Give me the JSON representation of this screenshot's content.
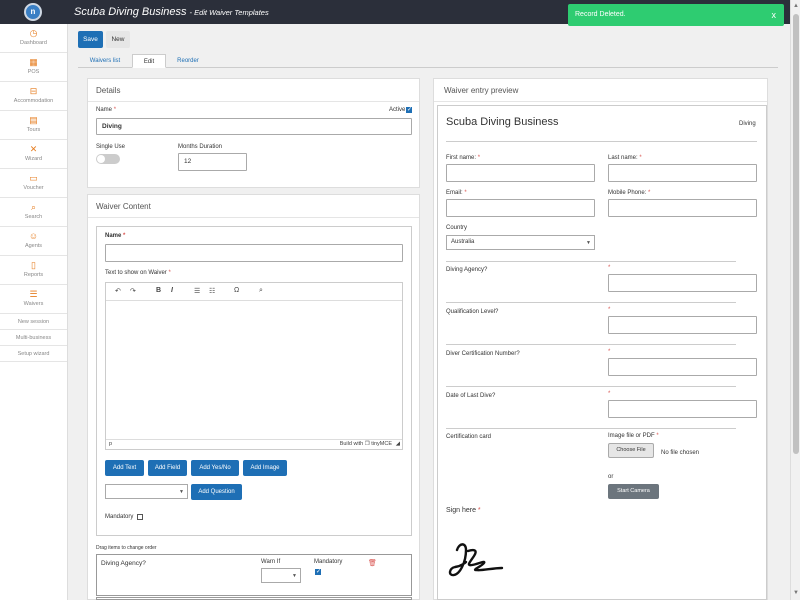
{
  "header": {
    "logo": "n",
    "title": "Scuba Diving Business",
    "subtitle": "- Edit Waiver Templates"
  },
  "toast": {
    "message": "Record Deleted.",
    "close": "x",
    "color": "#2ecc71"
  },
  "sidebar": {
    "items": [
      {
        "label": "Dashboard",
        "icon": "dashboard-icon",
        "glyph": "◷"
      },
      {
        "label": "POS",
        "icon": "pos-icon",
        "glyph": "▦"
      },
      {
        "label": "Accommodation",
        "icon": "bed-icon",
        "glyph": "⊟"
      },
      {
        "label": "Tours",
        "icon": "tours-icon",
        "glyph": "▤"
      },
      {
        "label": "Wizard",
        "icon": "wizard-icon",
        "glyph": "✕"
      },
      {
        "label": "Voucher",
        "icon": "voucher-icon",
        "glyph": "▭"
      },
      {
        "label": "Search",
        "icon": "search-icon",
        "glyph": "⌕"
      },
      {
        "label": "Agents",
        "icon": "agents-icon",
        "glyph": "☺"
      },
      {
        "label": "Reports",
        "icon": "reports-icon",
        "glyph": "▯"
      },
      {
        "label": "Waivers",
        "icon": "waivers-icon",
        "glyph": "☰"
      }
    ],
    "text_items": [
      "New session",
      "Multi-business",
      "Setup wizard"
    ]
  },
  "actions": {
    "save": "Save",
    "new": "New"
  },
  "tabs": [
    "Waivers list",
    "Edit",
    "Reorder"
  ],
  "details": {
    "title": "Details",
    "name_label": "Name",
    "name_value": "Diving",
    "active_label": "Active",
    "single_use_label": "Single Use",
    "months_label": "Months Duration",
    "months_value": "12"
  },
  "waiver_content": {
    "title": "Waiver Content",
    "name_label": "Name",
    "text_label": "Text to show on Waiver",
    "editor_path": "p",
    "editor_brand": "Build with ❐ tinyMCE",
    "buttons": [
      "Add Text",
      "Add Field",
      "Add Yes/No",
      "Add Image"
    ],
    "add_question": "Add Question",
    "mandatory_label": "Mandatory",
    "drag_hint": "Drag items to change order",
    "item": {
      "label": "Diving Agency?",
      "warn_if_label": "Warn If",
      "mandatory_label": "Mandatory"
    }
  },
  "preview": {
    "panel_title": "Waiver entry preview",
    "business": "Scuba Diving Business",
    "template": "Diving",
    "first_name": "First name:",
    "last_name": "Last name:",
    "email": "Email:",
    "mobile": "Mobile Phone:",
    "country_label": "Country",
    "country_value": "Australia",
    "questions": [
      "Diving Agency?",
      "Qualification Level?",
      "Diver Certification Number?",
      "Date of Last Dive?"
    ],
    "cert_label": "Certification card",
    "file_label": "Image file or PDF",
    "choose_file": "Choose File",
    "no_file": "No file chosen",
    "or": "or",
    "start_camera": "Start Camera",
    "sign_here": "Sign here"
  }
}
